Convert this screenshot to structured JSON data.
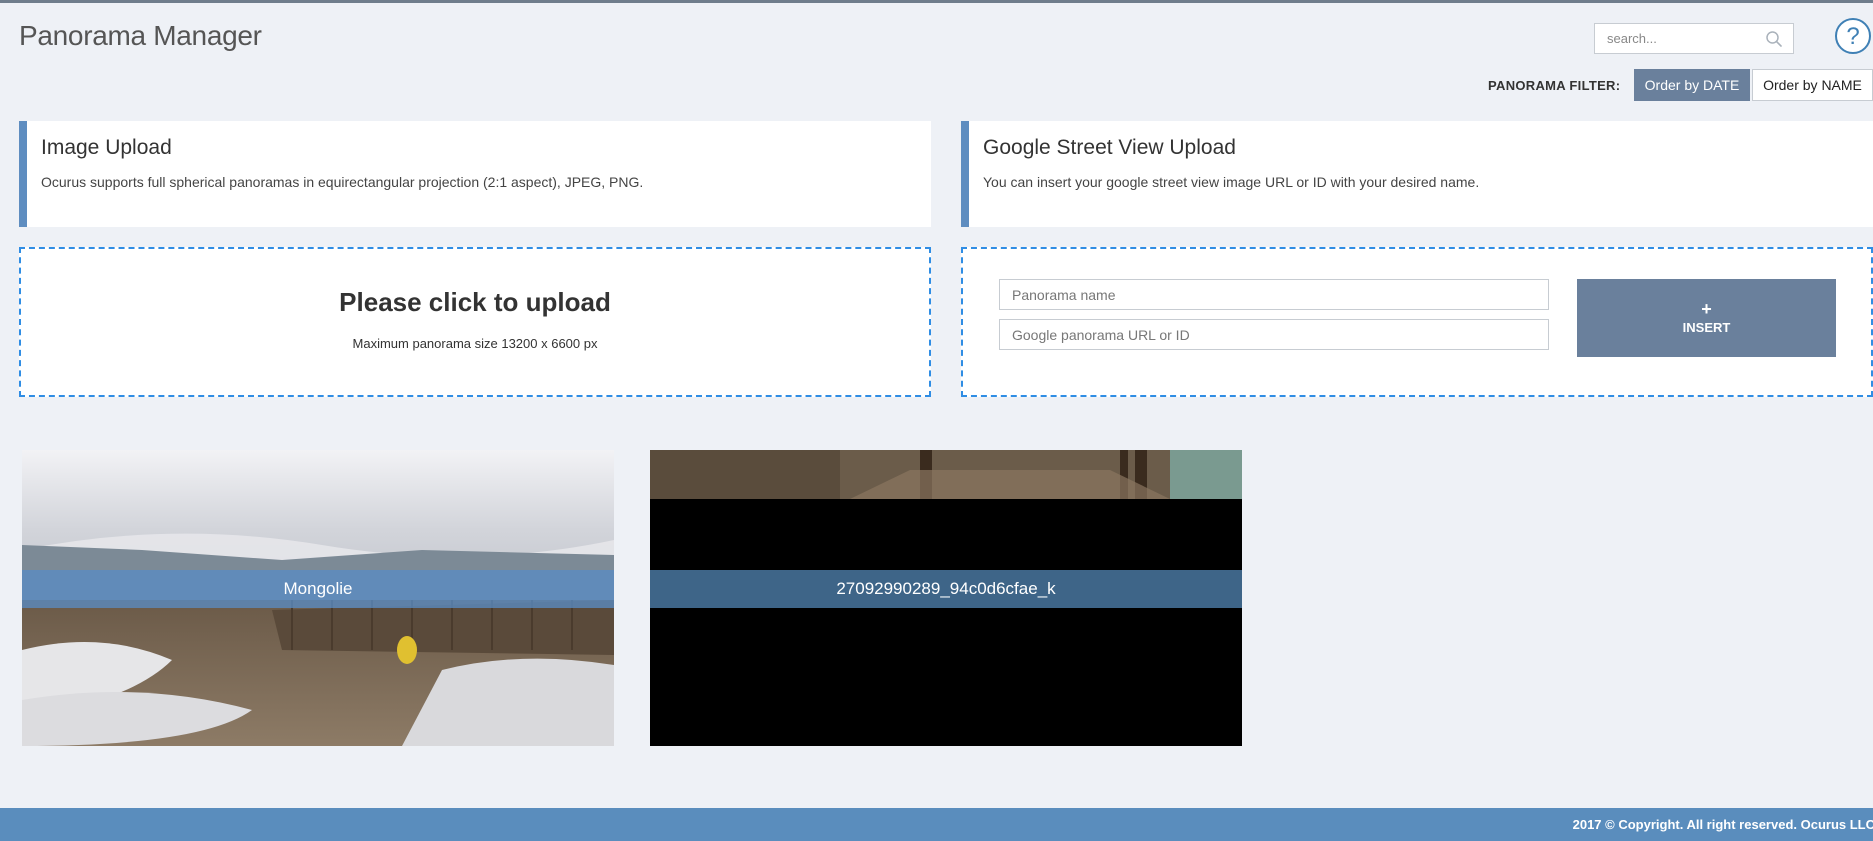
{
  "header": {
    "title": "Panorama Manager",
    "search_placeholder": "search...",
    "search_icon": "magnifier",
    "help_icon": "question-mark-circle"
  },
  "filter": {
    "label": "PANORAMA FILTER:",
    "order_by_date": "Order by DATE",
    "order_by_name": "Order by NAME",
    "active": "Order by DATE"
  },
  "image_upload": {
    "title": "Image Upload",
    "description": "Ocurus supports full spherical panoramas in equirectangular projection (2:1 aspect), JPEG, PNG.",
    "zone_title": "Please click to upload",
    "zone_subtitle": "Maximum panorama size 13200 x 6600 px"
  },
  "street_view": {
    "title": "Google Street View Upload",
    "description": "You can insert your google street view image URL or ID with your desired name.",
    "name_placeholder": "Panorama name",
    "url_placeholder": "Google panorama URL or ID",
    "insert_icon": "+",
    "insert_label": "INSERT"
  },
  "panoramas": [
    {
      "name": "Mongolie"
    },
    {
      "name": "27092990289_94c0d6cfae_k"
    }
  ],
  "footer": {
    "copyright": "2017 © Copyright. All right reserved. Ocurus LLC"
  },
  "colors": {
    "accent": "#6a809c",
    "brand_blue": "#5a8dbd",
    "dashed_border": "#2f8de4",
    "background": "#eef1f6"
  }
}
